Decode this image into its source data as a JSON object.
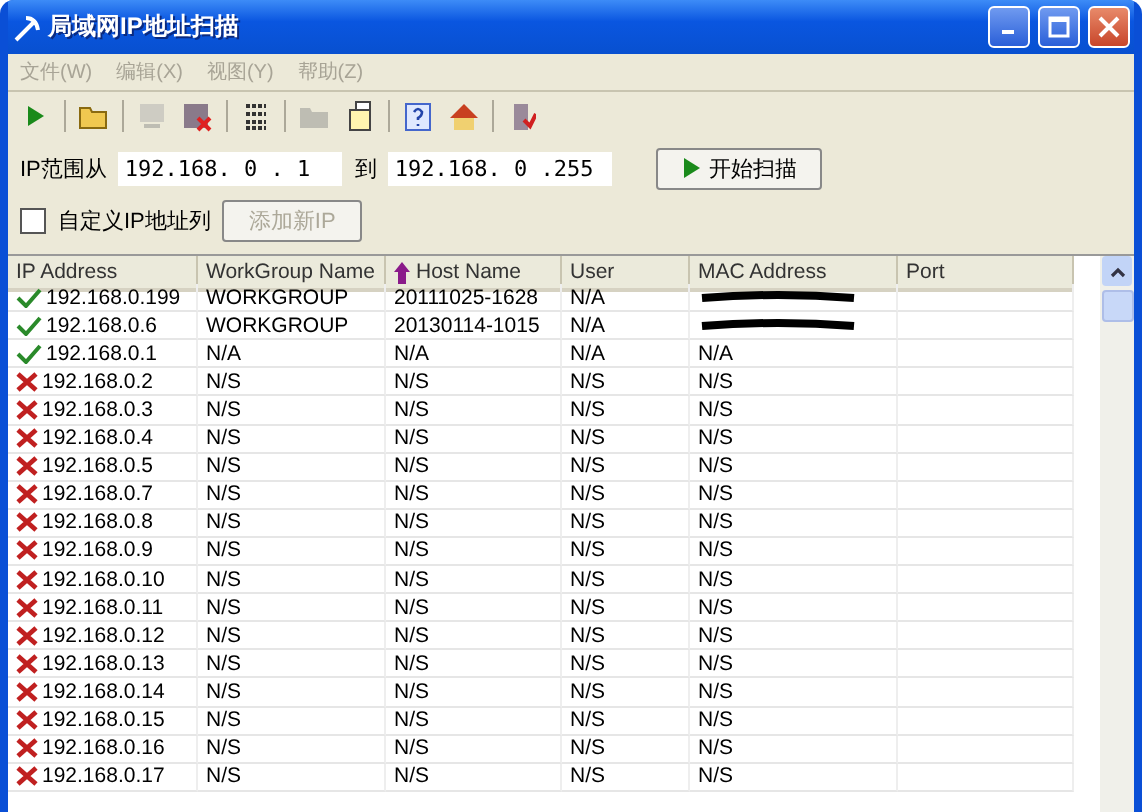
{
  "window": {
    "title": "局域网IP地址扫描"
  },
  "menu": [
    "文件(W)",
    "编辑(X)",
    "视图(Y)",
    "帮助(Z)"
  ],
  "toolbar": [
    {
      "kind": "play",
      "disabled": false
    },
    {
      "kind": "sep"
    },
    {
      "kind": "open",
      "disabled": false
    },
    {
      "kind": "sep"
    },
    {
      "kind": "computer",
      "disabled": true
    },
    {
      "kind": "delete",
      "disabled": false
    },
    {
      "kind": "sep"
    },
    {
      "kind": "list",
      "disabled": false
    },
    {
      "kind": "sep"
    },
    {
      "kind": "folder",
      "disabled": true
    },
    {
      "kind": "export",
      "disabled": false
    },
    {
      "kind": "sep"
    },
    {
      "kind": "help",
      "disabled": false
    },
    {
      "kind": "home",
      "disabled": false
    },
    {
      "kind": "sep"
    },
    {
      "kind": "exit",
      "disabled": false
    }
  ],
  "range": {
    "label": "IP范围从",
    "from": "192.168. 0 . 1",
    "to_label": "到",
    "to": "192.168. 0 .255",
    "scan_button": "开始扫描"
  },
  "custom": {
    "label": "自定义IP地址列",
    "checked": false,
    "add_button": "添加新IP",
    "add_disabled": true
  },
  "table": {
    "columns": [
      "IP Address",
      "WorkGroup Name",
      "Host Name",
      "User",
      "MAC Address",
      "Port"
    ],
    "rows": [
      {
        "found": true,
        "cells": [
          "192.168.0.199",
          "WORKGROUP",
          "20111025-1628",
          "N/A",
          null,
          ""
        ]
      },
      {
        "found": true,
        "cells": [
          "192.168.0.6",
          "WORKGROUP",
          "20130114-1015",
          "N/A",
          null,
          ""
        ]
      },
      {
        "found": true,
        "cells": [
          "192.168.0.1",
          "N/A",
          "N/A",
          "N/A",
          "N/A",
          ""
        ]
      },
      {
        "found": false,
        "cells": [
          "192.168.0.2",
          "N/S",
          "N/S",
          "N/S",
          "N/S",
          ""
        ]
      },
      {
        "found": false,
        "cells": [
          "192.168.0.3",
          "N/S",
          "N/S",
          "N/S",
          "N/S",
          ""
        ]
      },
      {
        "found": false,
        "cells": [
          "192.168.0.4",
          "N/S",
          "N/S",
          "N/S",
          "N/S",
          ""
        ]
      },
      {
        "found": false,
        "cells": [
          "192.168.0.5",
          "N/S",
          "N/S",
          "N/S",
          "N/S",
          ""
        ]
      },
      {
        "found": false,
        "cells": [
          "192.168.0.7",
          "N/S",
          "N/S",
          "N/S",
          "N/S",
          ""
        ]
      },
      {
        "found": false,
        "cells": [
          "192.168.0.8",
          "N/S",
          "N/S",
          "N/S",
          "N/S",
          ""
        ]
      },
      {
        "found": false,
        "cells": [
          "192.168.0.9",
          "N/S",
          "N/S",
          "N/S",
          "N/S",
          ""
        ]
      },
      {
        "found": false,
        "cells": [
          "192.168.0.10",
          "N/S",
          "N/S",
          "N/S",
          "N/S",
          ""
        ]
      },
      {
        "found": false,
        "cells": [
          "192.168.0.11",
          "N/S",
          "N/S",
          "N/S",
          "N/S",
          ""
        ]
      },
      {
        "found": false,
        "cells": [
          "192.168.0.12",
          "N/S",
          "N/S",
          "N/S",
          "N/S",
          ""
        ]
      },
      {
        "found": false,
        "cells": [
          "192.168.0.13",
          "N/S",
          "N/S",
          "N/S",
          "N/S",
          ""
        ]
      },
      {
        "found": false,
        "cells": [
          "192.168.0.14",
          "N/S",
          "N/S",
          "N/S",
          "N/S",
          ""
        ]
      },
      {
        "found": false,
        "cells": [
          "192.168.0.15",
          "N/S",
          "N/S",
          "N/S",
          "N/S",
          ""
        ]
      },
      {
        "found": false,
        "cells": [
          "192.168.0.16",
          "N/S",
          "N/S",
          "N/S",
          "N/S",
          ""
        ]
      },
      {
        "found": false,
        "cells": [
          "192.168.0.17",
          "N/S",
          "N/S",
          "N/S",
          "N/S",
          ""
        ]
      }
    ]
  }
}
